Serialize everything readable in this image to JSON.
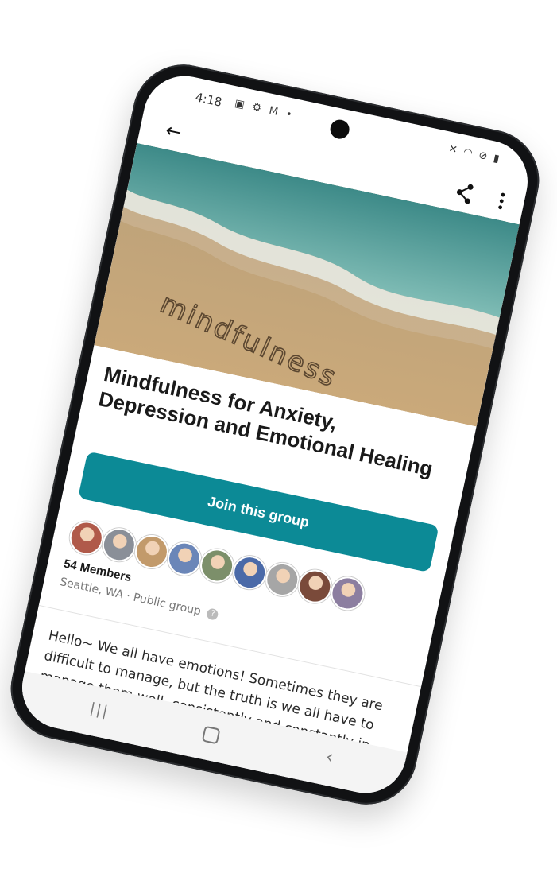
{
  "status_bar": {
    "time": "4:18",
    "left_icons": [
      "image-icon",
      "gear-icon",
      "gmail-icon",
      "dot-icon"
    ],
    "right_icons": [
      "mute-icon",
      "wifi-icon",
      "dnd-icon",
      "battery-icon"
    ]
  },
  "app_bar": {
    "back_icon": "arrow-left-icon",
    "share_icon": "share-icon",
    "more_icon": "more-vertical-icon"
  },
  "hero": {
    "sand_writing": "mindfulness"
  },
  "group": {
    "title": "Mindfulness for Anxiety, Depression and Emotional Healing",
    "join_label": "Join this group",
    "members_label": "54 Members",
    "location": "Seattle, WA",
    "separator": "·",
    "visibility": "Public group",
    "description": "Hello~ We all have emotions! Sometimes they are difficult to manage, but the truth is we all have to manage them well, consistently and constantly in our lives. This meetup is for EVERYONE, not just those with more"
  },
  "avatars": [
    "#b05a4a",
    "#8a8f98",
    "#c29a6b",
    "#6b86b8",
    "#7c8f6a",
    "#4b6aa8",
    "#a6a6a6",
    "#7a4a3a",
    "#8c7ea0"
  ],
  "colors": {
    "accent": "#0c8a96",
    "frame": "#111214"
  },
  "nav_bar": {
    "recents_icon": "recents-icon",
    "home_icon": "home-icon",
    "back_icon": "nav-back-icon"
  }
}
